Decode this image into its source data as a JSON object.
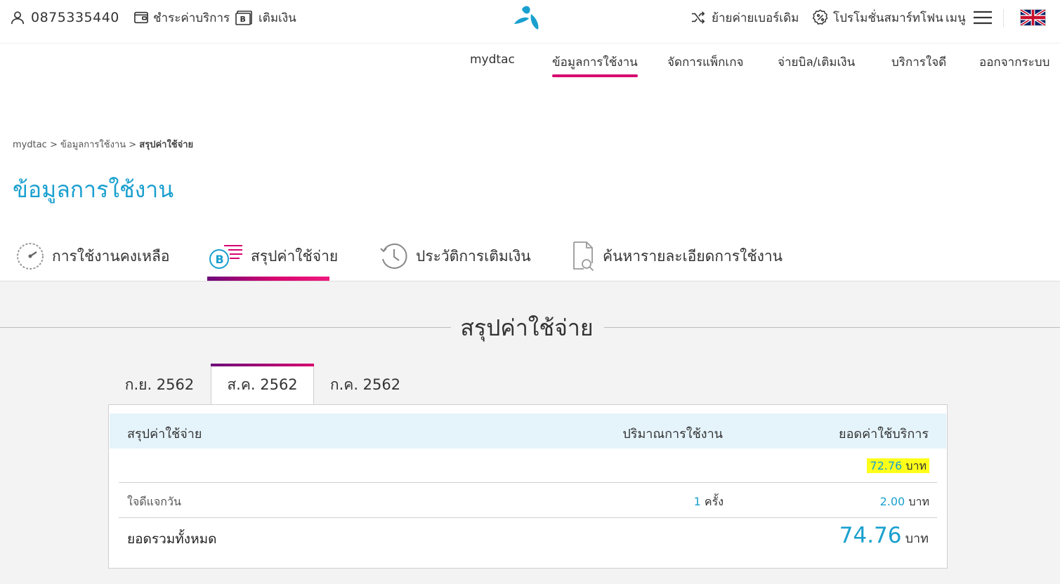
{
  "topbar": {
    "phone": "0875335440",
    "pay_bill": "ชำระค่าบริการ",
    "top_up": "เติมเงิน",
    "move_network": "ย้ายค่ายเบอร์เดิม",
    "promotion": "โปรโมชั่นสมาร์ทโฟน",
    "menu": "เมนู"
  },
  "mainnav": {
    "items": [
      "mydtac",
      "ข้อมูลการใช้งาน",
      "จัดการแพ็กเกจ",
      "จ่ายบิล/เติมเงิน",
      "บริการใจดี",
      "ออกจากระบบ"
    ],
    "active": "ข้อมูลการใช้งาน"
  },
  "breadcrumb": {
    "items": [
      "mydtac",
      "ข้อมูลการใช้งาน",
      "สรุปค่าใช้จ่าย"
    ],
    "separator": ">"
  },
  "page_title": "ข้อมูลการใช้งาน",
  "section_tabs": {
    "items": [
      "การใช้งานคงเหลือ",
      "สรุปค่าใช้จ่าย",
      "ประวัติการเติมเงิน",
      "ค้นหารายละเอียดการใช้งาน"
    ],
    "active": "สรุปค่าใช้จ่าย"
  },
  "summary": {
    "title": "สรุปค่าใช้จ่าย",
    "month_tabs": [
      "ก.ย. 2562",
      "ส.ค. 2562",
      "ก.ค. 2562"
    ],
    "active_month": "ส.ค. 2562",
    "headers": [
      "สรุปค่าใช้จ่าย",
      "ปริมาณการใช้งาน",
      "ยอดค่าใช้บริการ"
    ],
    "rows": [
      {
        "label": "",
        "quantity": "",
        "quantity_unit": "",
        "amount": "72.76",
        "unit": "บาท",
        "highlighted": true
      },
      {
        "label": "ใจดีแจกวัน",
        "quantity": "1",
        "quantity_unit": "ครั้ง",
        "amount": "2.00",
        "unit": "บาท",
        "highlighted": false
      }
    ],
    "total": {
      "label": "ยอดรวมทั้งหมด",
      "amount": "74.76",
      "unit": "บาท"
    }
  },
  "colors": {
    "accent_blue": "#1aa0cf",
    "accent_pink": "#d6046f",
    "accent_purple": "#6d0a7a",
    "header_row_bg": "#e5f4fb",
    "highlight_yellow": "#ffff1a"
  },
  "icons": [
    "user-icon",
    "wallet-icon",
    "baht-card-icon",
    "dtac-logo",
    "shuffle-icon",
    "percent-badge-icon",
    "hamburger-icon",
    "uk-flag-icon",
    "speedometer-icon",
    "baht-bill-icon",
    "history-clock-icon",
    "document-search-icon"
  ]
}
